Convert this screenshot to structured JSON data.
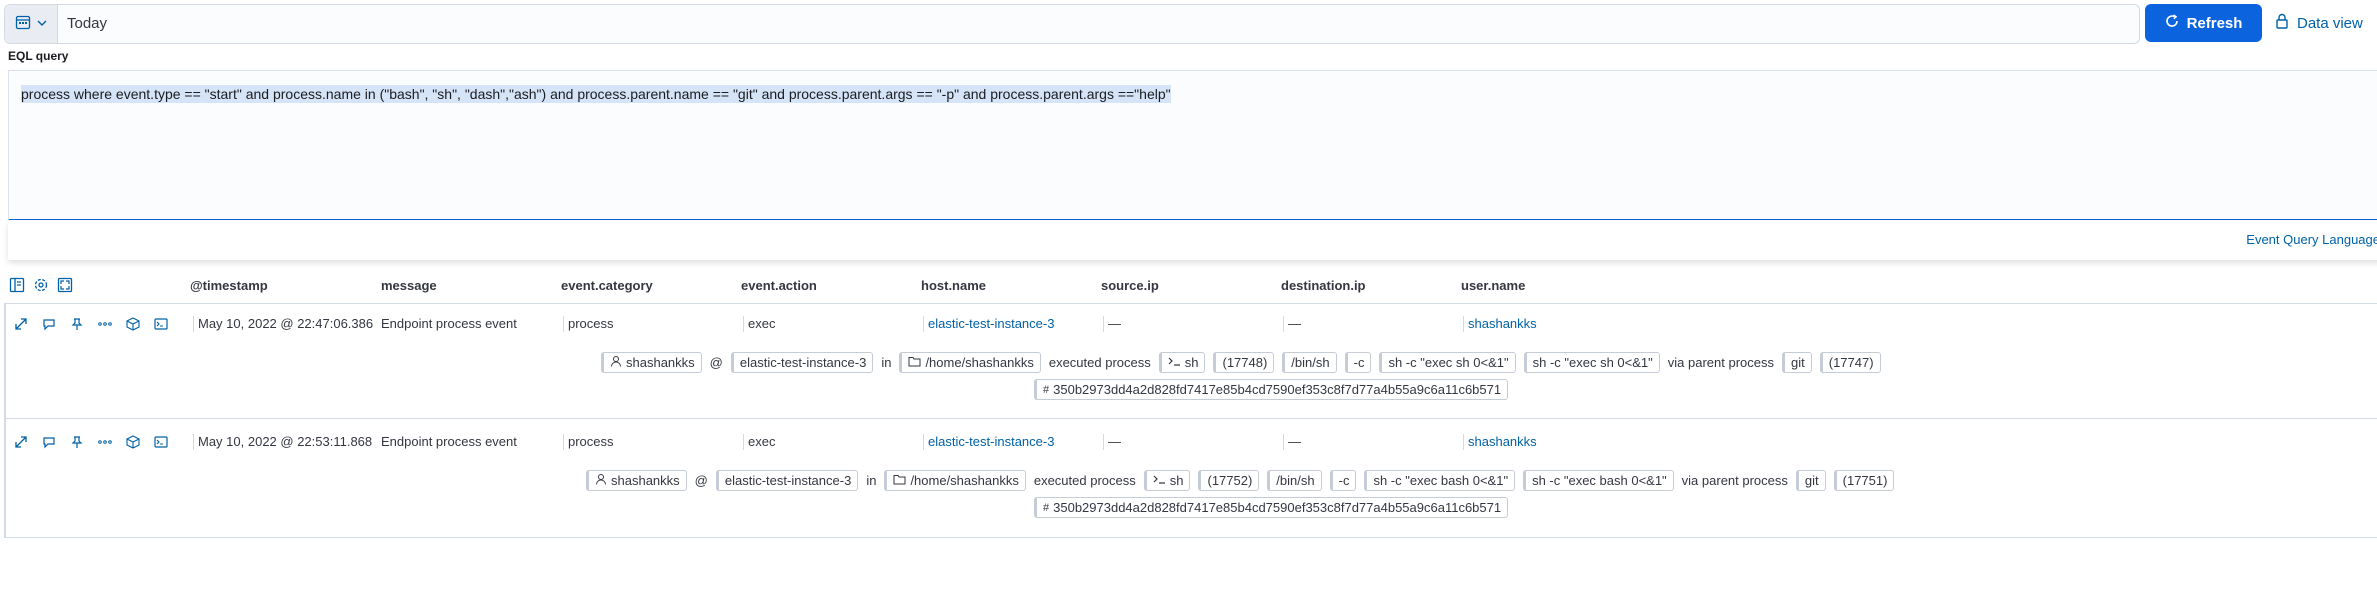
{
  "datepicker": {
    "value": "Today"
  },
  "refresh_label": "Refresh",
  "dataview_label": "Data view",
  "eql": {
    "label": "EQL query",
    "query": "process where event.type == \"start\" and process.name in (\"bash\", \"sh\", \"dash\",\"ash\") and process.parent.name == \"git\" and process.parent.args == \"-p\" and process.parent.args ==\"help\"",
    "footer_link": "Event Query Language"
  },
  "columns": [
    "@timestamp",
    "message",
    "event.category",
    "event.action",
    "host.name",
    "source.ip",
    "destination.ip",
    "user.name"
  ],
  "rows": [
    {
      "timestamp": "May 10, 2022 @ 22:47:06.386",
      "message": "Endpoint process event",
      "category": "process",
      "action": "exec",
      "host": "elastic-test-instance-3",
      "source_ip": "—",
      "destination_ip": "—",
      "user": "shashankks",
      "r_user": "shashankks",
      "r_at": "@",
      "r_host": "elastic-test-instance-3",
      "r_in": "in",
      "r_dir": "/home/shashankks",
      "r_executed": "executed process",
      "r_proc": "sh",
      "r_pid": "(17748)",
      "r_path": "/bin/sh",
      "r_arg1": "-c",
      "r_arg2": "sh -c \"exec sh 0<&1\"",
      "r_arg3": "sh -c \"exec sh 0<&1\"",
      "r_via": "via parent process",
      "r_parent": "git",
      "r_ppid": "(17747)",
      "r_hash": "350b2973dd4a2d828fd7417e85b4cd7590ef353c8f7d77a4b55a9c6a11c6b571"
    },
    {
      "timestamp": "May 10, 2022 @ 22:53:11.868",
      "message": "Endpoint process event",
      "category": "process",
      "action": "exec",
      "host": "elastic-test-instance-3",
      "source_ip": "—",
      "destination_ip": "—",
      "user": "shashankks",
      "r_user": "shashankks",
      "r_at": "@",
      "r_host": "elastic-test-instance-3",
      "r_in": "in",
      "r_dir": "/home/shashankks",
      "r_executed": "executed process",
      "r_proc": "sh",
      "r_pid": "(17752)",
      "r_path": "/bin/sh",
      "r_arg1": "-c",
      "r_arg2": "sh -c \"exec bash 0<&1\"",
      "r_arg3": "sh -c \"exec bash 0<&1\"",
      "r_via": "via parent process",
      "r_parent": "git",
      "r_ppid": "(17751)",
      "r_hash": "350b2973dd4a2d828fd7417e85b4cd7590ef353c8f7d77a4b55a9c6a11c6b571"
    }
  ],
  "colors": {
    "accent": "#0b64dd",
    "link": "#0061a6",
    "border": "#d3dae6"
  }
}
